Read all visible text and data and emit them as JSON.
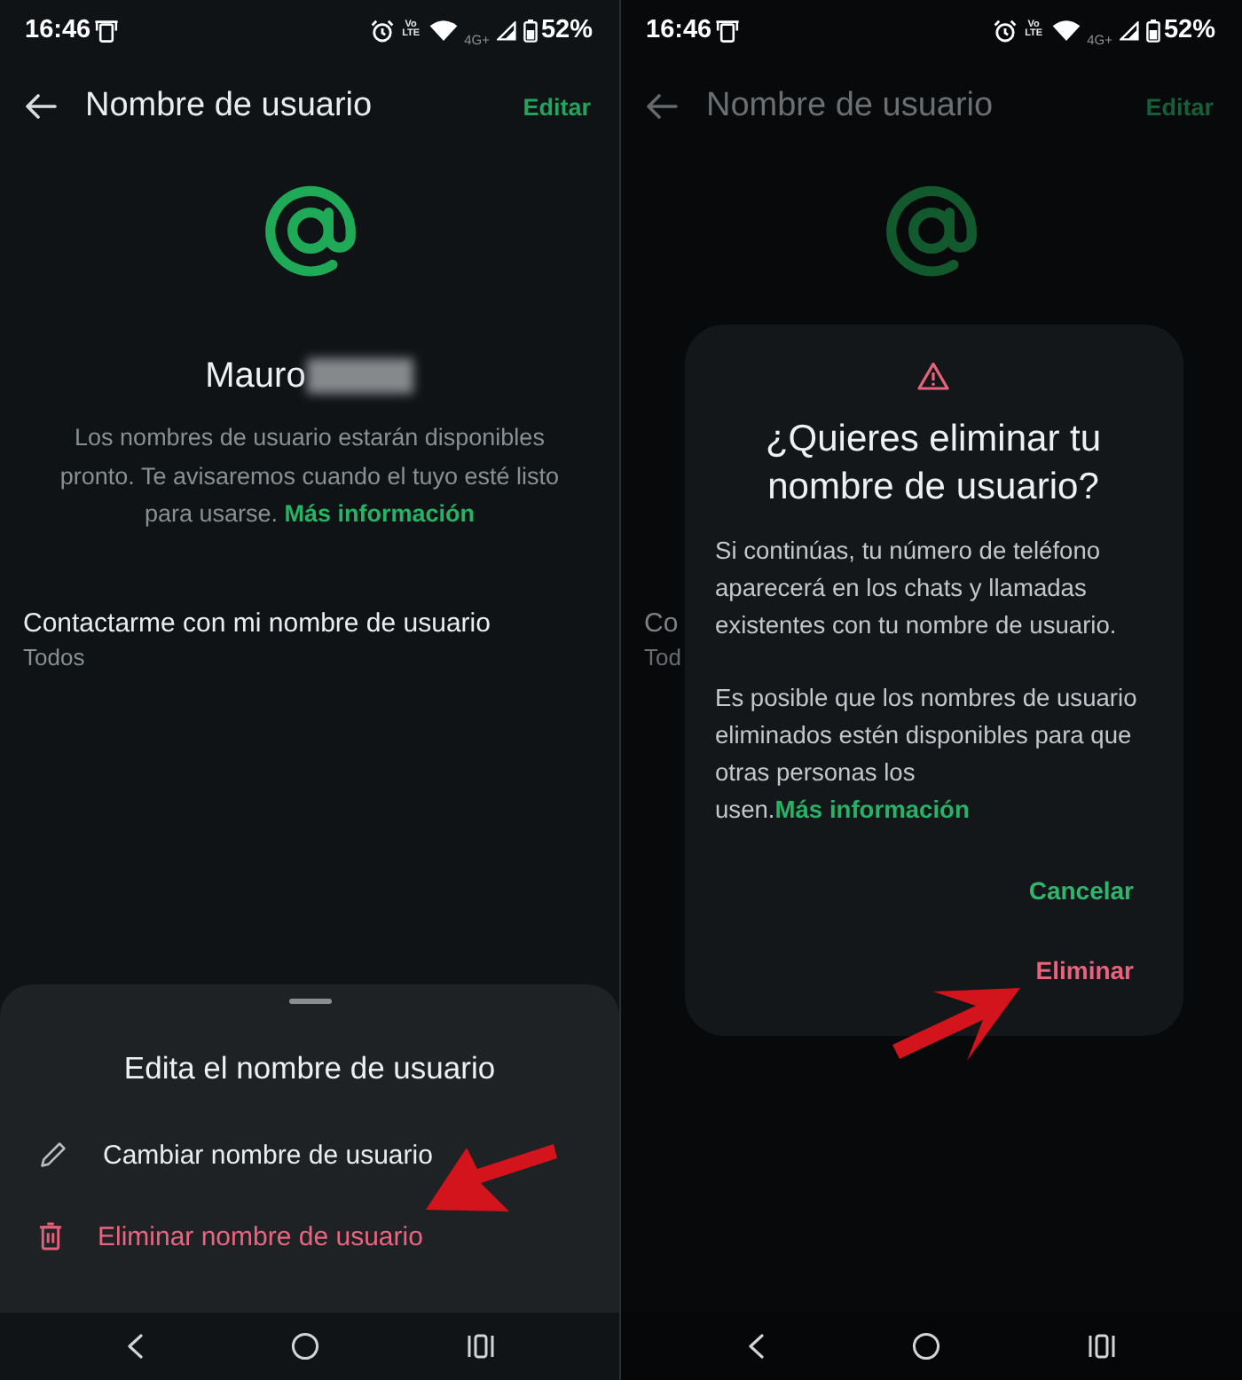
{
  "screens": [
    {
      "dimmed": false,
      "status_bar": {
        "time": "16:46",
        "volte": "Vo LTE",
        "network": "4G+",
        "battery": "52%"
      },
      "app_bar": {
        "title": "Nombre de usuario",
        "action": "Editar"
      },
      "profile": {
        "name": "Mauro",
        "redacted": true,
        "note": "Los nombres de usuario estarán disponibles pronto. Te avisaremos cuando el tuyo esté listo para usarse.",
        "link": "Más información"
      },
      "setting": {
        "label": "Contactarme con mi nombre de usuario",
        "value": "Todos"
      },
      "sheet": {
        "title": "Edita el nombre de usuario",
        "items": [
          {
            "kind": "edit",
            "label": "Cambiar nombre de usuario",
            "danger": false
          },
          {
            "kind": "delete",
            "label": "Eliminar nombre de usuario",
            "danger": true
          }
        ]
      }
    },
    {
      "dimmed": true,
      "status_bar": {
        "time": "16:46",
        "volte": "Vo LTE",
        "network": "4G+",
        "battery": "52%"
      },
      "app_bar": {
        "title": "Nombre de usuario",
        "action": "Editar"
      },
      "setting": {
        "label": "Co",
        "value": "Tod"
      },
      "dialog": {
        "title": "¿Quieres eliminar tu nombre de usuario?",
        "paragraphs": [
          {
            "text": "Si continúas, tu número de teléfono aparecerá en los chats y llamadas existentes con tu nombre de usuario."
          },
          {
            "text": "Es posible que los nombres de usuario eliminados estén disponibles para que otras personas los usen.",
            "link": "Más información"
          }
        ],
        "buttons": [
          {
            "kind": "cancel",
            "label": "Cancelar"
          },
          {
            "kind": "destructive",
            "label": "Eliminar"
          }
        ]
      }
    }
  ]
}
